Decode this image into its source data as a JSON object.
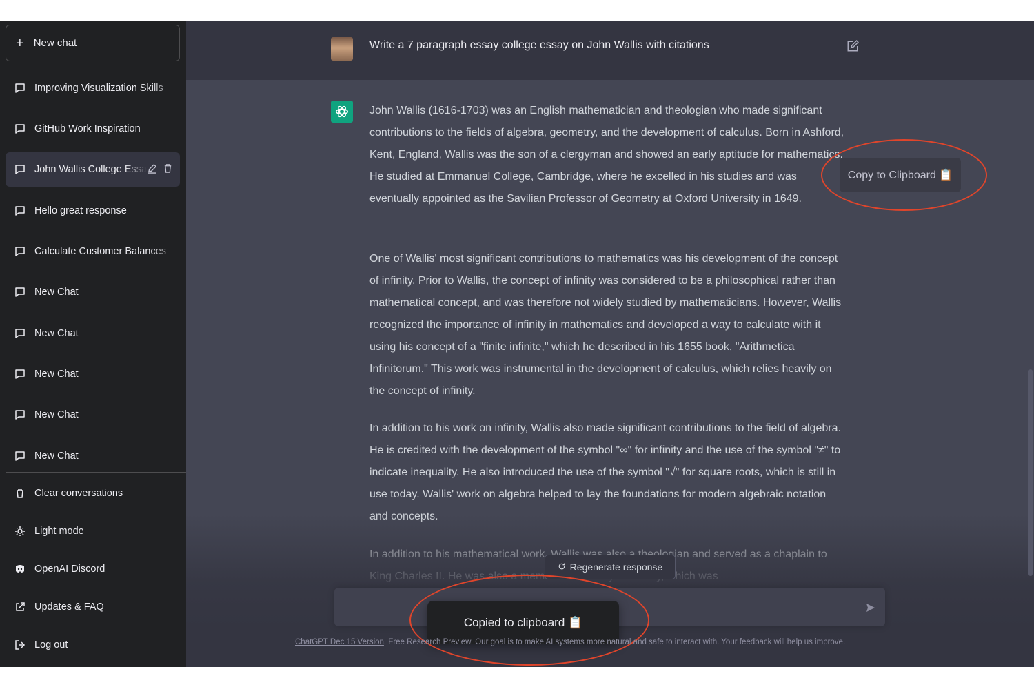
{
  "sidebar": {
    "new_chat_label": "New chat",
    "conversations": [
      "Improving Visualization Skills",
      "GitHub Work Inspiration",
      "John Wallis College Essay",
      "Hello great response",
      "Calculate Customer Balances",
      "New Chat",
      "New Chat",
      "New Chat",
      "New Chat",
      "New Chat"
    ],
    "actions": [
      {
        "label": "Clear conversations",
        "icon": "trash-icon"
      },
      {
        "label": "Light mode",
        "icon": "sun-icon"
      },
      {
        "label": "OpenAI Discord",
        "icon": "discord-icon"
      },
      {
        "label": "Updates & FAQ",
        "icon": "external-link-icon"
      },
      {
        "label": "Log out",
        "icon": "logout-icon"
      }
    ]
  },
  "chat": {
    "user_message": "Write a 7 paragraph essay college essay on John Wallis with citations",
    "assistant_paragraphs": [
      "John Wallis (1616-1703) was an English mathematician and theologian who made significant contributions to the fields of algebra, geometry, and the development of calculus. Born in Ashford, Kent, England, Wallis was the son of a clergyman and showed an early aptitude for mathematics. He studied at Emmanuel College, Cambridge, where he excelled in his studies and was eventually appointed as the Savilian Professor of Geometry at Oxford University in 1649.",
      "One of Wallis' most significant contributions to mathematics was his development of the concept of infinity. Prior to Wallis, the concept of infinity was considered to be a philosophical rather than mathematical concept, and was therefore not widely studied by mathematicians. However, Wallis recognized the importance of infinity in mathematics and developed a way to calculate with it using his concept of a \"finite infinite,\" which he described in his 1655 book, \"Arithmetica Infinitorum.\" This work was instrumental in the development of calculus, which relies heavily on the concept of infinity.",
      "In addition to his work on infinity, Wallis also made significant contributions to the field of algebra. He is credited with the development of the symbol \"∞\" for infinity and the use of the symbol \"≠\" to indicate inequality. He also introduced the use of the symbol \"√\" for square roots, which is still in use today. Wallis' work on algebra helped to lay the foundations for modern algebraic notation and concepts.",
      "In addition to his mathematical work, Wallis was also a theologian and served as a chaplain to King Charles II. He was also a member of the Royal Society, which was"
    ],
    "copy_button_label": "Copy to Clipboard 📋",
    "regenerate_label": "Regenerate response",
    "input_placeholder": "",
    "toast_label": "Copied to clipboard 📋",
    "footer_link": "ChatGPT Dec 15 Version",
    "footer_text": ". Free Research Preview. Our goal is to make AI systems more natural and safe to interact with. Your feedback will help us improve."
  },
  "colors": {
    "sidebar_bg": "#202123",
    "main_bg": "#343541",
    "assistant_bg": "#444654",
    "accent": "#10a37f",
    "annotation": "#e0452b"
  }
}
